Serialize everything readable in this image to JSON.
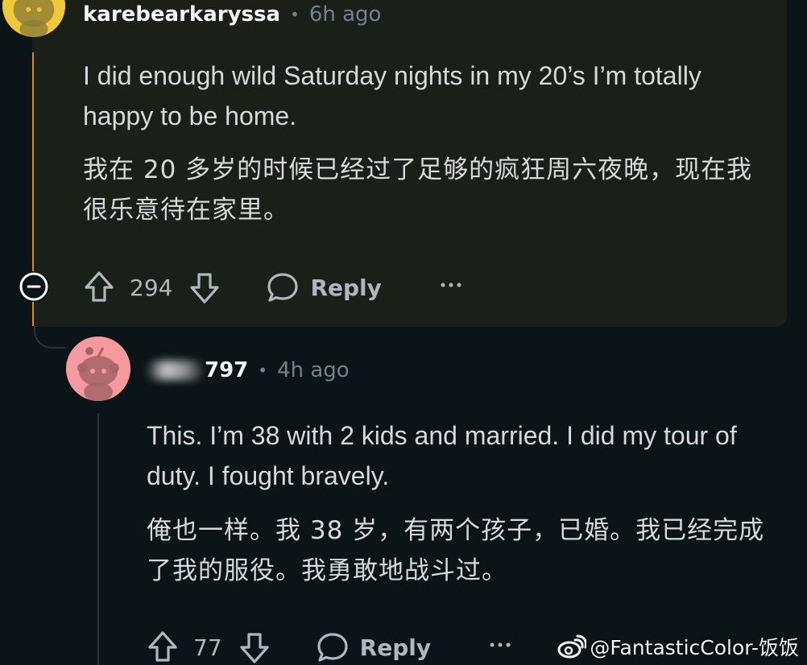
{
  "comments": [
    {
      "username": "karebearkaryssa",
      "separator": "•",
      "time": "6h ago",
      "body": "I did enough wild Saturday nights in my 20’s I’m totally happy to be home.",
      "translation": "我在 20 多岁的时候已经过了足够的疯狂周六夜晚，现在我很乐意待在家里。",
      "votes": "294",
      "reply_label": "Reply",
      "avatar_color": "#f0c83b",
      "collapse_icon": "collapse-icon"
    },
    {
      "username": "797",
      "username_redaction": "blurred-prefix",
      "separator": "•",
      "time": "4h ago",
      "body": "This. I’m 38 with 2 kids and married. I did my tour of duty. I fought bravely.",
      "translation": "俺也一样。我 38 岁，有两个孩子，已婚。我已经完成了我的服役。我勇敢地战斗过。",
      "votes": "77",
      "reply_label": "Reply",
      "avatar_color": "#f59aa1"
    }
  ],
  "icons": {
    "upvote": "upvote-icon",
    "downvote": "downvote-icon",
    "reply": "speech-bubble-icon",
    "more": "more-options-icon",
    "watermark_logo": "weibo-logo-icon"
  },
  "watermark": {
    "text": "@FantasticColor-饭饭"
  },
  "colors": {
    "background": "#0b1416",
    "highlighted_comment": "#1b1f1a",
    "thread_highlight": "#d58b25",
    "text": "#d7dadc",
    "muted": "#73818c",
    "action": "#aeb8be"
  }
}
